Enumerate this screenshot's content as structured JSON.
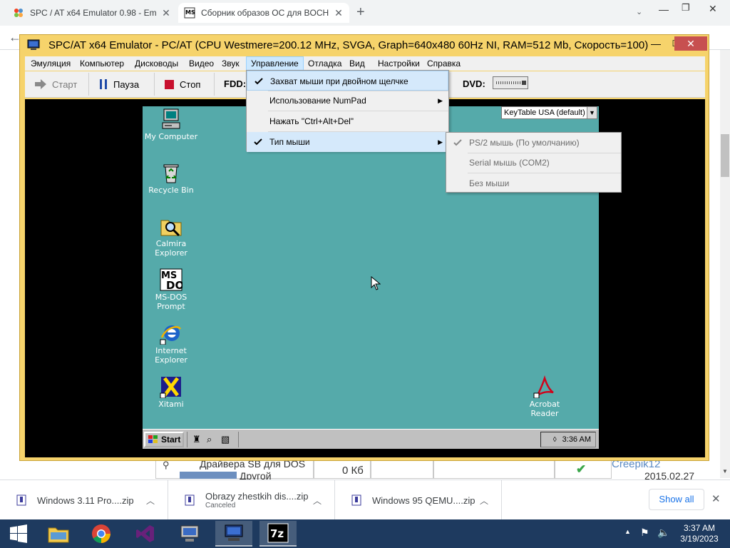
{
  "browser": {
    "tabs": [
      {
        "title": "SPC / AT x64 Emulator 0.98 - Em"
      },
      {
        "title": "Сборник образов ОС для BOCH"
      }
    ],
    "new_tab_label": "+"
  },
  "emulator": {
    "title": "SPC/AT x64 Emulator - PC/AT (CPU Westmere=200.12 MHz, SVGA, Graph=640x480 60Hz NI, RAM=512 Mb, Скорость=100)",
    "menu": [
      "Эмуляция",
      "Компьютер",
      "Дисководы",
      "Видео",
      "Звук",
      "Управление",
      "Отладка",
      "Вид",
      "Настройки",
      "Справка"
    ],
    "active_menu": "Управление",
    "toolbar": {
      "start": "Старт",
      "pause": "Пауза",
      "stop": "Стоп",
      "fdd": "FDD:",
      "dvd": "DVD:"
    },
    "control_menu": [
      {
        "label": "Захват мыши при двойном щелчке",
        "checked": true,
        "submenu": false
      },
      {
        "label": "Использование NumPad",
        "checked": false,
        "submenu": true
      },
      {
        "label": "Нажать \"Ctrl+Alt+Del\"",
        "checked": false,
        "submenu": false
      },
      {
        "label": "Тип мыши",
        "checked": true,
        "submenu": true
      }
    ],
    "mouse_type_menu": [
      {
        "label": "PS/2 мышь (По умолчанию)",
        "checked": true
      },
      {
        "label": "Serial мышь (COM2)",
        "checked": false
      },
      {
        "label": "Без мыши",
        "checked": false
      }
    ],
    "keytable": "KeyTable USA (default)"
  },
  "guest": {
    "icons": [
      {
        "line1": "My Computer",
        "line2": ""
      },
      {
        "line1": "Recycle Bin",
        "line2": ""
      },
      {
        "line1": "Calmira",
        "line2": "Explorer"
      },
      {
        "line1": "MS-DOS",
        "line2": "Prompt"
      },
      {
        "line1": "Internet",
        "line2": "Explorer"
      },
      {
        "line1": "Xitami",
        "line2": ""
      },
      {
        "line1": "Acrobat",
        "line2": "Reader"
      }
    ],
    "start_label": "Start",
    "clock": "3:36 AM",
    "desktop_color": "#55aaaa"
  },
  "page_behind": {
    "row_name": "Драйвера SB для DOS",
    "row_sub": "Другой",
    "size": "0 Кб",
    "author": "Creepik12",
    "date": "2015.02.27"
  },
  "downloads": [
    {
      "name": "Windows 3.11 Pro....zip",
      "status": ""
    },
    {
      "name": "Obrazy zhestkih dis....zip",
      "status": "Canceled"
    },
    {
      "name": "Windows 95 QEMU....zip",
      "status": ""
    }
  ],
  "downloads_show_all": "Show all",
  "taskbar": {
    "time": "3:37 AM",
    "date": "3/19/2023"
  }
}
